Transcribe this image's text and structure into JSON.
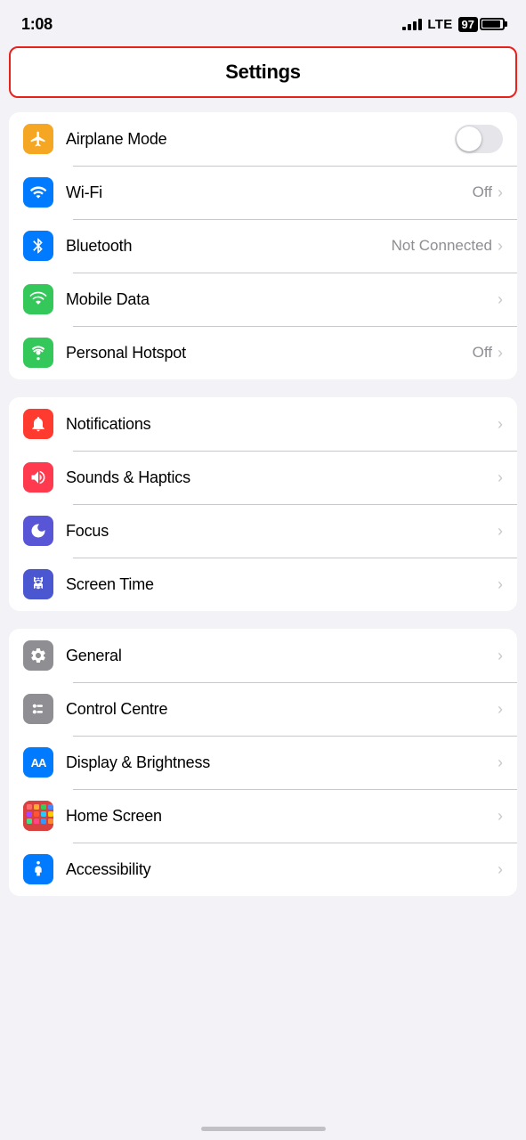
{
  "statusBar": {
    "time": "1:08",
    "lte": "LTE",
    "batteryPercent": "97"
  },
  "titleBar": {
    "label": "Settings"
  },
  "groups": [
    {
      "id": "connectivity",
      "items": [
        {
          "id": "airplane-mode",
          "label": "Airplane Mode",
          "iconBg": "orange",
          "iconType": "airplane",
          "valueType": "toggle",
          "toggleOn": false
        },
        {
          "id": "wifi",
          "label": "Wi-Fi",
          "iconBg": "blue",
          "iconType": "wifi",
          "valueType": "chevron",
          "value": "Off"
        },
        {
          "id": "bluetooth",
          "label": "Bluetooth",
          "iconBg": "blue",
          "iconType": "bluetooth",
          "valueType": "chevron",
          "value": "Not Connected"
        },
        {
          "id": "mobile-data",
          "label": "Mobile Data",
          "iconBg": "green",
          "iconType": "signal",
          "valueType": "chevron",
          "value": ""
        },
        {
          "id": "personal-hotspot",
          "label": "Personal Hotspot",
          "iconBg": "green",
          "iconType": "hotspot",
          "valueType": "chevron",
          "value": "Off"
        }
      ]
    },
    {
      "id": "notifications",
      "items": [
        {
          "id": "notifications",
          "label": "Notifications",
          "iconBg": "red",
          "iconType": "bell",
          "valueType": "chevron",
          "value": ""
        },
        {
          "id": "sounds-haptics",
          "label": "Sounds & Haptics",
          "iconBg": "pink-red",
          "iconType": "sound",
          "valueType": "chevron",
          "value": ""
        },
        {
          "id": "focus",
          "label": "Focus",
          "iconBg": "purple",
          "iconType": "moon",
          "valueType": "chevron",
          "value": ""
        },
        {
          "id": "screen-time",
          "label": "Screen Time",
          "iconBg": "indigo",
          "iconType": "hourglass",
          "valueType": "chevron",
          "value": ""
        }
      ]
    },
    {
      "id": "display",
      "items": [
        {
          "id": "general",
          "label": "General",
          "iconBg": "gray",
          "iconType": "gear",
          "valueType": "chevron",
          "value": ""
        },
        {
          "id": "control-centre",
          "label": "Control Centre",
          "iconBg": "gray",
          "iconType": "sliders",
          "valueType": "chevron",
          "value": ""
        },
        {
          "id": "display-brightness",
          "label": "Display & Brightness",
          "iconBg": "blue",
          "iconType": "aa",
          "valueType": "chevron",
          "value": ""
        },
        {
          "id": "home-screen",
          "label": "Home Screen",
          "iconBg": "multicolor",
          "iconType": "grid",
          "valueType": "chevron",
          "value": ""
        },
        {
          "id": "accessibility",
          "label": "Accessibility",
          "iconBg": "blue",
          "iconType": "accessibility",
          "valueType": "chevron",
          "value": ""
        }
      ]
    }
  ]
}
